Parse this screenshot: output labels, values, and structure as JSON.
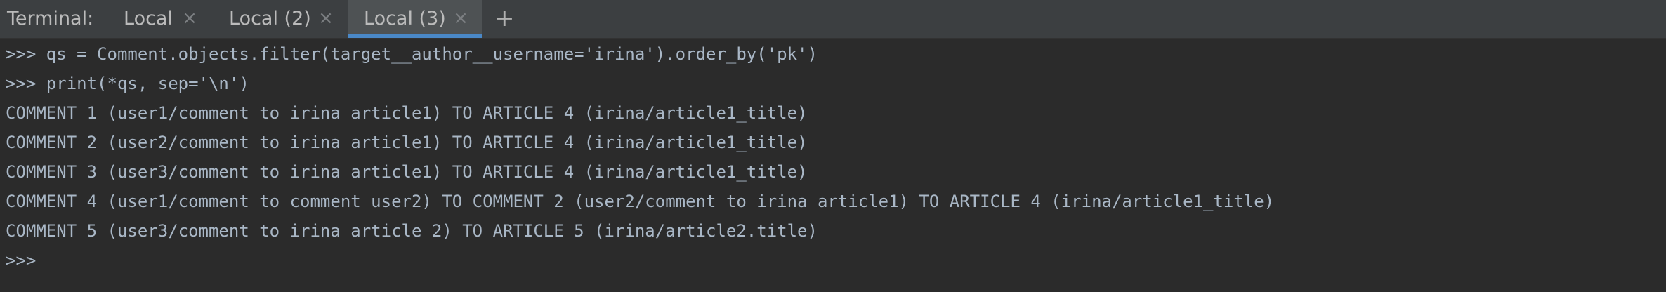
{
  "tabbar": {
    "title": "Terminal:",
    "tabs": [
      {
        "label": "Local",
        "close": "×"
      },
      {
        "label": "Local (2)",
        "close": "×"
      },
      {
        "label": "Local (3)",
        "close": "×"
      }
    ],
    "new_tab": "+"
  },
  "terminal": {
    "lines": [
      ">>> qs = Comment.objects.filter(target__author__username='irina').order_by('pk')",
      ">>> print(*qs, sep='\\n')",
      "COMMENT 1 (user1/comment to irina article1) TO ARTICLE 4 (irina/article1_title)",
      "COMMENT 2 (user2/comment to irina article1) TO ARTICLE 4 (irina/article1_title)",
      "COMMENT 3 (user3/comment to irina article1) TO ARTICLE 4 (irina/article1_title)",
      "COMMENT 4 (user1/comment to comment user2) TO COMMENT 2 (user2/comment to irina article1) TO ARTICLE 4 (irina/article1_title)",
      "COMMENT 5 (user3/comment to irina article 2) TO ARTICLE 5 (irina/article2.title)",
      ">>>"
    ]
  },
  "colors": {
    "tabbar_bg": "#3c3f41",
    "terminal_bg": "#2b2b2b",
    "active_tab_underline": "#4a88c7",
    "text": "#a9b7c6"
  }
}
